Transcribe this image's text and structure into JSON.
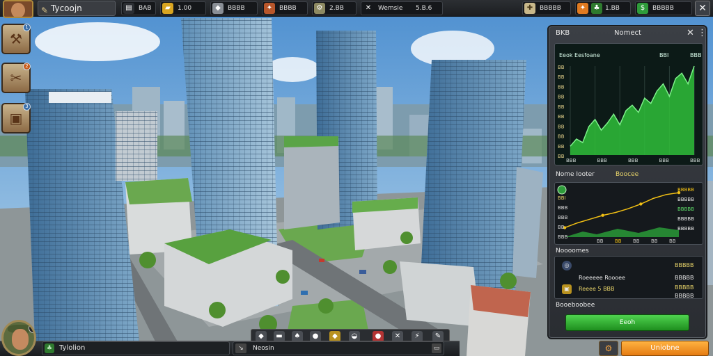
{
  "top_bar": {
    "game_title": "Tycoojn",
    "resources": [
      {
        "icon": "coin-stack-icon",
        "value": "BAB",
        "color": "#2b2e33"
      },
      {
        "icon": "gold-bar-icon",
        "value": "1.00",
        "color": "#d9a520"
      },
      {
        "icon": "gem-icon",
        "value": "BBBB",
        "color": "#8a8f96"
      },
      {
        "icon": "fire-icon",
        "value": "BBBB",
        "color": "#b8562a"
      },
      {
        "icon": "gear-coin-icon",
        "value": "2.BB",
        "color": "#8d8a62"
      }
    ],
    "tools_label": "Wemsie",
    "tools_value": "5.B.6",
    "right_resources": [
      {
        "icon": "wrench-icon",
        "value": "BBBBB",
        "color": "#c8b88a"
      },
      {
        "icon": "fire-icon",
        "value": "1.BB",
        "color": "#e07a20"
      },
      {
        "icon": "dollar-icon",
        "value": "BBBBB",
        "color": "#2e9b3a"
      }
    ]
  },
  "side_buttons": [
    {
      "badge": "1"
    },
    {
      "badge": "2"
    },
    {
      "badge": "3"
    }
  ],
  "bottom_bar": {
    "player_level": "6",
    "player_name": "Tylolion",
    "field_label": "Neosin"
  },
  "tools": [
    {
      "icon": "stone-icon",
      "color": "#6b6f75"
    },
    {
      "icon": "wood-icon",
      "color": "#8b5a2b"
    },
    {
      "icon": "leaf-icon",
      "color": "#4b5a3a"
    },
    {
      "icon": "rock-icon",
      "color": "#5f6a6e"
    },
    {
      "icon": "gold-icon",
      "color": "#b9921f"
    },
    {
      "icon": "helmet-icon",
      "color": "#5d6167"
    },
    {
      "icon": "bag-icon",
      "color": "#b43434"
    },
    {
      "icon": "tools-icon",
      "color": "#5d6167"
    },
    {
      "icon": "bolt-icon",
      "color": "#5d6167"
    },
    {
      "icon": "hammer-icon",
      "color": "#5d6167"
    }
  ],
  "panel": {
    "header_left": "BKB",
    "header_center": "Nomect",
    "chart_subhead": "Eeok Eesfoane",
    "chart_subval": "BBI",
    "chart_subval2": "BBB",
    "y_ticks": [
      "BB",
      "BB",
      "BB",
      "BB",
      "BB",
      "BB",
      "BB",
      "BB",
      "BB",
      "BB"
    ],
    "x_ticks": [
      "BBB",
      "BBB",
      "BBB",
      "BBB",
      "BBB"
    ],
    "section2_title": "Nome Iooter",
    "section2_title2": "Boocee",
    "section2_labels": [
      "BBI",
      "BBB",
      "BBB",
      "BB",
      "BBB"
    ],
    "section2_values": [
      "BBBBB",
      "BBBBB",
      "BBBBB",
      "BBBBB",
      "BBBBB"
    ],
    "section2_xticks": [
      "BB",
      "BB",
      "BB",
      "BB",
      "BB"
    ],
    "section3_title": "Noooomes",
    "stat_value_1": "BBBBB",
    "stat_value_2": "BBBBB",
    "stat_value_3": "BBBBB",
    "stat_label_1": "Roeeeee Roooee",
    "stat_label_2": "Reeee 5 BBB",
    "stat_value_4": "BBBBB",
    "section4_title": "Booeboobee",
    "action_button": "Eeoh",
    "close": "✕"
  },
  "upgrade_button": "Uniobne",
  "chart_data": [
    {
      "type": "area",
      "x": [
        0,
        1,
        2,
        3,
        4,
        5,
        6,
        7,
        8,
        9,
        10,
        11,
        12,
        13,
        14,
        15,
        16,
        17,
        18,
        19,
        20
      ],
      "series": [
        {
          "values": [
            10,
            18,
            14,
            32,
            40,
            28,
            36,
            46,
            34,
            50,
            56,
            48,
            64,
            58,
            72,
            80,
            66,
            86,
            92,
            80,
            100
          ]
        }
      ],
      "ylim": [
        0,
        100
      ],
      "color": "#2fbf3a"
    },
    {
      "type": "line",
      "x": [
        0,
        1,
        2,
        3,
        4,
        5,
        6,
        7,
        8,
        9
      ],
      "series": [
        {
          "values": [
            20,
            30,
            38,
            46,
            52,
            60,
            70,
            82,
            90,
            94
          ]
        }
      ],
      "ylim": [
        0,
        100
      ],
      "color": "#f2c014"
    }
  ]
}
